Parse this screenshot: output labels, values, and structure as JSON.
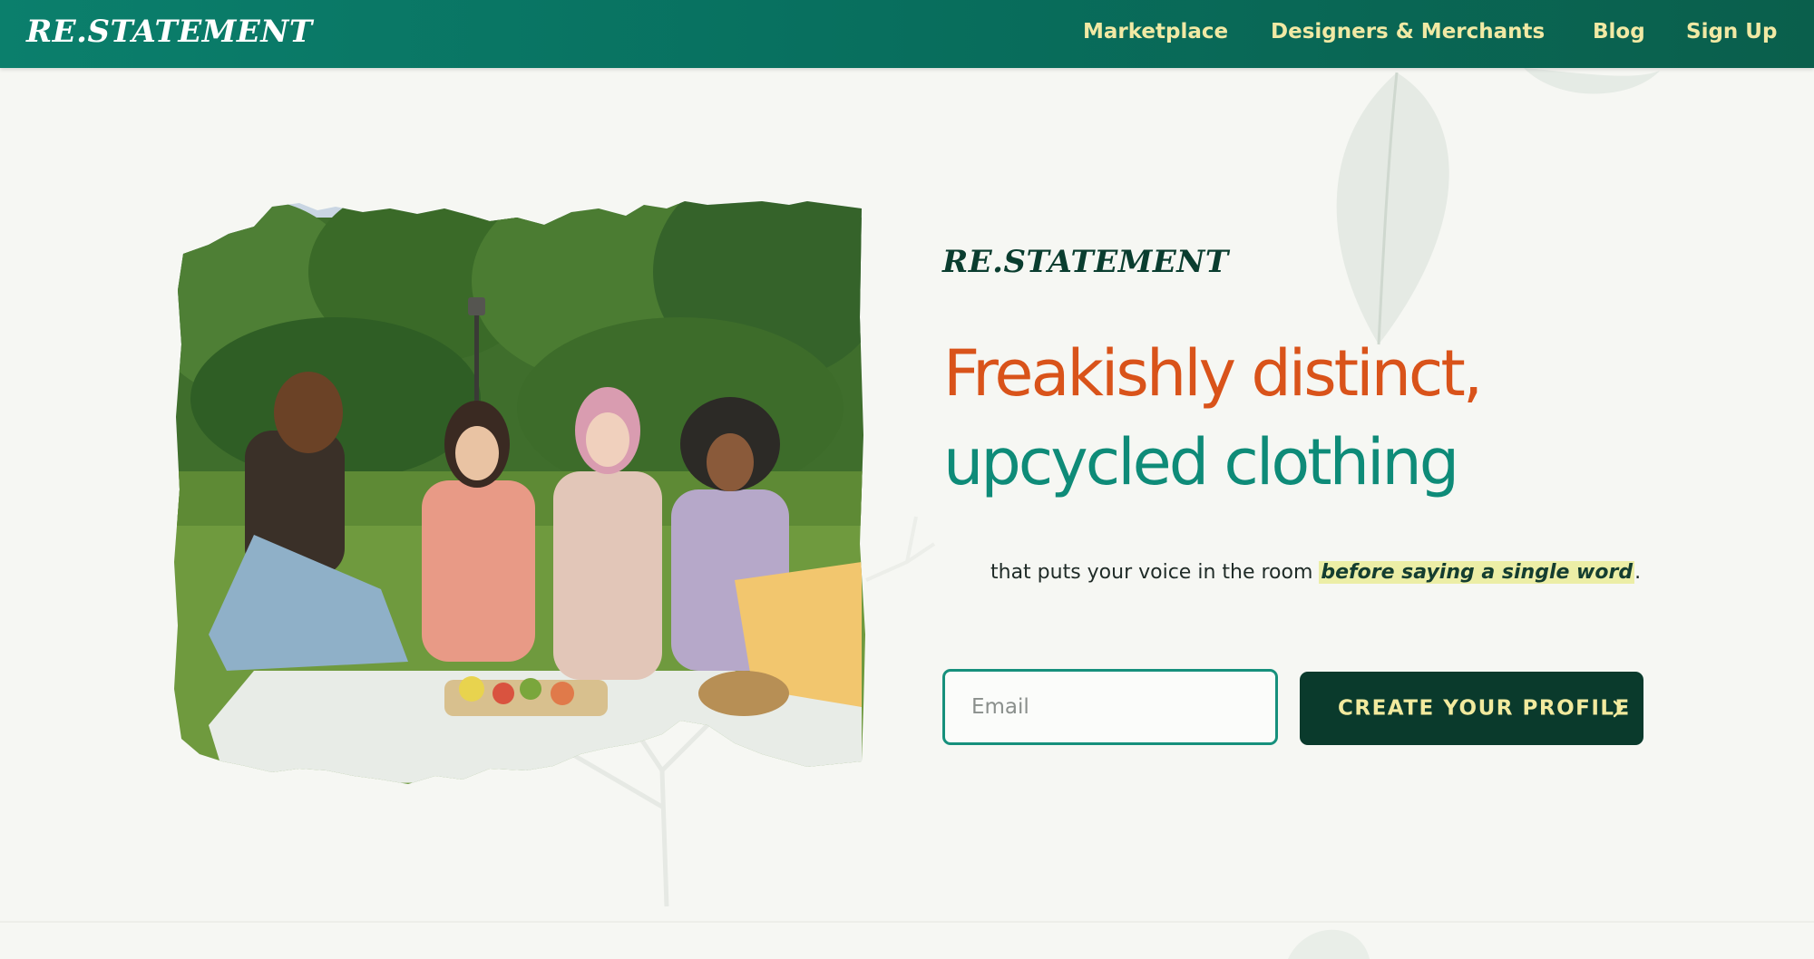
{
  "header": {
    "logo": "RE.STATEMENT",
    "nav": [
      {
        "label": "Marketplace"
      },
      {
        "label": "Designers & Merchants"
      },
      {
        "label": "Blog"
      },
      {
        "label": "Sign Up"
      }
    ]
  },
  "hero": {
    "brand": "RE.STATEMENT",
    "headline_line1": "Freakishly distinct,",
    "headline_line2": "upcycled clothing",
    "tagline_prefix": "that puts your voice in the room ",
    "tagline_emphasis": "before saying a single word",
    "tagline_suffix": ".",
    "email_placeholder": "Email",
    "email_value": "",
    "cta_label": "CREATE YOUR PROFILE",
    "cta_icon": "chevron-right-icon"
  },
  "colors": {
    "header_bg": "#08705f",
    "nav_text": "#f1e9a4",
    "headline_orange": "#d9531a",
    "headline_teal": "#0e8b78",
    "cta_bg": "#0a3a2c",
    "cta_text": "#f2ea9e",
    "highlight": "#eceea6"
  }
}
